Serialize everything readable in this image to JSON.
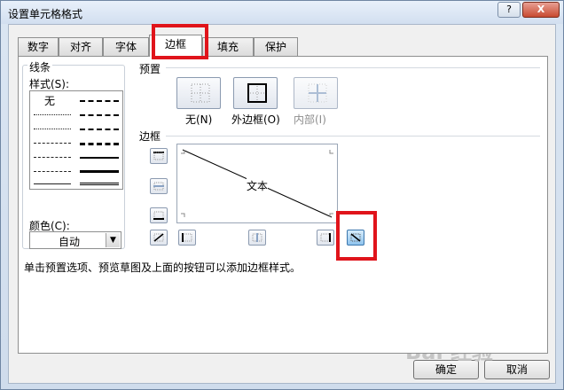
{
  "window": {
    "title": "设置单元格格式",
    "help": "?",
    "close": "X"
  },
  "tabs": [
    {
      "label": "数字"
    },
    {
      "label": "对齐"
    },
    {
      "label": "字体"
    },
    {
      "label": "边框"
    },
    {
      "label": "填充"
    },
    {
      "label": "保护"
    }
  ],
  "active_tab": "边框",
  "line": {
    "group_title": "线条",
    "style_label": "样式(S):",
    "none_label": "无",
    "color_label": "颜色(C):",
    "color_value": "自动"
  },
  "presets": {
    "title": "预置",
    "none": "无(N)",
    "outline": "外边框(O)",
    "inside": "内部(I)"
  },
  "border": {
    "title": "边框",
    "preview_text": "文本"
  },
  "hint": "单击预置选项、预览草图及上面的按钮可以添加边框样式。",
  "buttons": {
    "ok": "确定",
    "cancel": "取消"
  },
  "watermark": "Bai 经验",
  "colors": {
    "highlight": "#e0141b",
    "active_button": "#8fc4ee"
  }
}
